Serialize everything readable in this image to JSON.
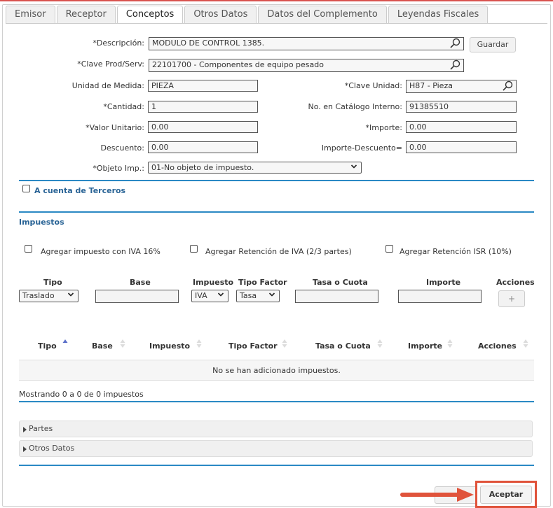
{
  "tabs": [
    "Emisor",
    "Receptor",
    "Conceptos",
    "Otros Datos",
    "Datos del Complemento",
    "Leyendas Fiscales"
  ],
  "active_tab": "Conceptos",
  "form": {
    "descripcion_label": "*Descripción:",
    "descripcion_value": "MODULO DE CONTROL 1385.",
    "guardar_label": "Guardar",
    "clave_prod_label": "*Clave Prod/Serv:",
    "clave_prod_value": "22101700 - Componentes de equipo pesado",
    "unidad_medida_label": "Unidad de Medida:",
    "unidad_medida_value": "PIEZA",
    "clave_unidad_label": "*Clave Unidad:",
    "clave_unidad_value": "H87 - Pieza",
    "cantidad_label": "*Cantidad:",
    "cantidad_value": "1",
    "no_catalogo_label": "No. en Catálogo Interno:",
    "no_catalogo_value": "91385510",
    "valor_unitario_label": "*Valor Unitario:",
    "valor_unitario_value": "0.00",
    "importe_label": "*Importe:",
    "importe_value": "0.00",
    "descuento_label": "Descuento:",
    "descuento_value": "0.00",
    "importe_descuento_label": "Importe-Descuento=",
    "importe_descuento_value": "0.00",
    "objeto_imp_label": "*Objeto Imp.:",
    "objeto_imp_value": "01-No objeto de impuesto."
  },
  "terceros_label": "A cuenta de Terceros",
  "impuestos": {
    "title": "Impuestos",
    "check_iva": "Agregar impuesto con  IVA 16%",
    "check_ret_iva": "Agregar Retención de IVA (2/3 partes)",
    "check_ret_isr": "Agregar Retención ISR (10%)",
    "entry_headers": [
      "Tipo",
      "Base",
      "Impuesto",
      "Tipo Factor",
      "Tasa o Cuota",
      "Importe",
      "Acciones"
    ],
    "tipo_value": "Traslado",
    "impuesto_value": "IVA",
    "tipo_factor_value": "Tasa",
    "add_label": "+"
  },
  "table": {
    "headers": [
      "Tipo",
      "Base",
      "Impuesto",
      "Tipo Factor",
      "Tasa o Cuota",
      "Importe",
      "Acciones"
    ],
    "empty_message": "No se han adicionado impuestos.",
    "footer": "Mostrando 0 a 0 de 0 impuestos"
  },
  "collapsibles": [
    "Partes",
    "Otros Datos"
  ],
  "accept_label": "Aceptar",
  "colors": {
    "accent": "#2a89c4",
    "highlight": "#e0533b"
  }
}
